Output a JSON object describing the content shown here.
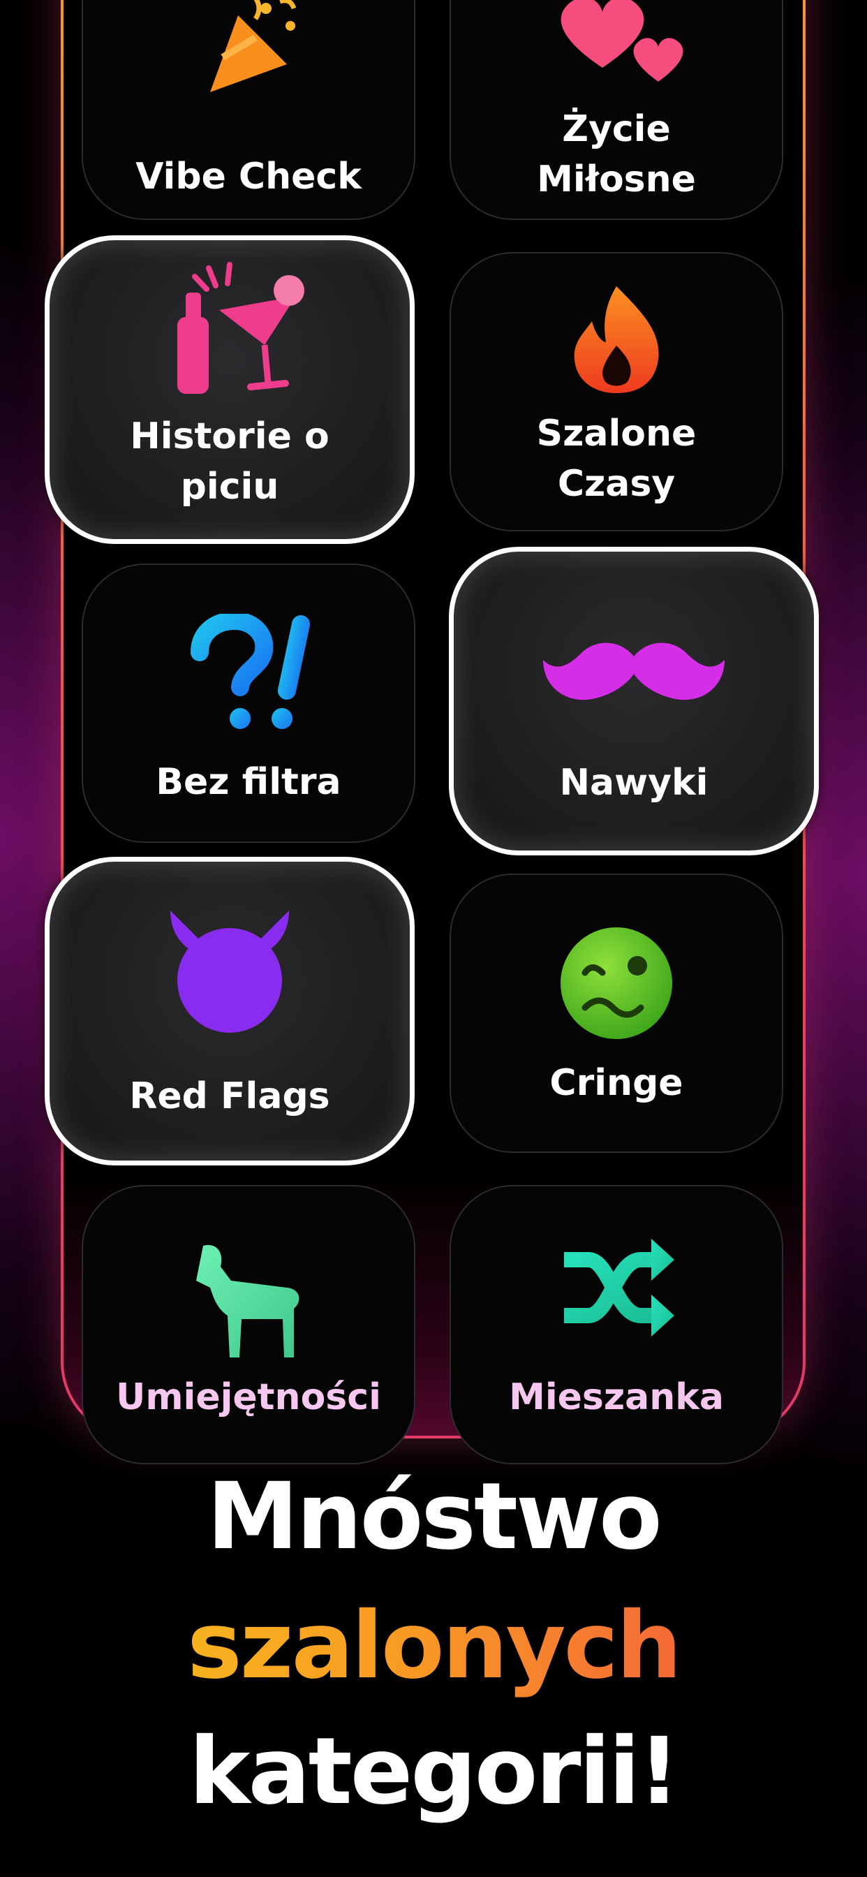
{
  "categories": [
    {
      "label": "Vibe Check",
      "icon": "party-popper-icon",
      "selected": false
    },
    {
      "label": "Życie\nMiłosne",
      "icon": "two-hearts-icon",
      "selected": false
    },
    {
      "label": "Historie o\npiciu",
      "icon": "drinks-clink-icon",
      "selected": true
    },
    {
      "label": "Szalone\nCzasy",
      "icon": "fire-icon",
      "selected": false
    },
    {
      "label": "Bez filtra",
      "icon": "question-exclamation-icon",
      "selected": false
    },
    {
      "label": "Nawyki",
      "icon": "mustache-icon",
      "selected": true
    },
    {
      "label": "Red Flags",
      "icon": "devil-face-icon",
      "selected": true
    },
    {
      "label": "Cringe",
      "icon": "woozy-face-icon",
      "selected": false
    },
    {
      "label": "Umiejętności",
      "icon": "goat-icon",
      "selected": false
    },
    {
      "label": "Mieszanka",
      "icon": "shuffle-icon",
      "selected": false
    }
  ],
  "headline": {
    "line1": "Mnóstwo",
    "line2": "szalonych",
    "line3": "kategorii!"
  },
  "colors": {
    "frame_gradient": [
      "#f6a12d",
      "#e23a6a"
    ],
    "headline_accent": [
      "#f7b21f",
      "#f56a37"
    ],
    "selected_border": "#ffffff"
  }
}
